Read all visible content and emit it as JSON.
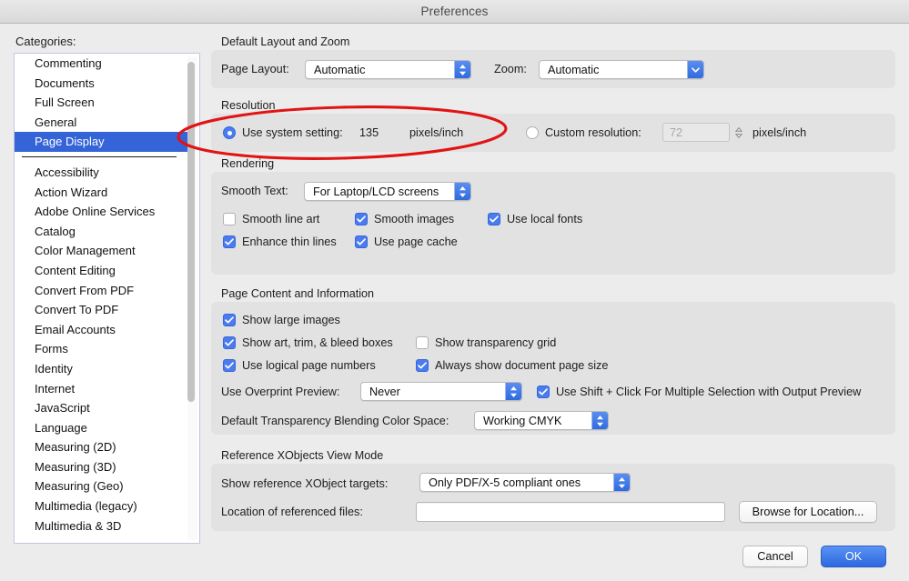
{
  "window": {
    "title": "Preferences"
  },
  "sidebar": {
    "label": "Categories:",
    "items": [
      {
        "label": "Commenting",
        "selected": false
      },
      {
        "label": "Documents",
        "selected": false
      },
      {
        "label": "Full Screen",
        "selected": false
      },
      {
        "label": "General",
        "selected": false
      },
      {
        "label": "Page Display",
        "selected": true
      },
      {
        "label": "Accessibility",
        "selected": false
      },
      {
        "label": "Action Wizard",
        "selected": false
      },
      {
        "label": "Adobe Online Services",
        "selected": false
      },
      {
        "label": "Catalog",
        "selected": false
      },
      {
        "label": "Color Management",
        "selected": false
      },
      {
        "label": "Content Editing",
        "selected": false
      },
      {
        "label": "Convert From PDF",
        "selected": false
      },
      {
        "label": "Convert To PDF",
        "selected": false
      },
      {
        "label": "Email Accounts",
        "selected": false
      },
      {
        "label": "Forms",
        "selected": false
      },
      {
        "label": "Identity",
        "selected": false
      },
      {
        "label": "Internet",
        "selected": false
      },
      {
        "label": "JavaScript",
        "selected": false
      },
      {
        "label": "Language",
        "selected": false
      },
      {
        "label": "Measuring (2D)",
        "selected": false
      },
      {
        "label": "Measuring (3D)",
        "selected": false
      },
      {
        "label": "Measuring (Geo)",
        "selected": false
      },
      {
        "label": "Multimedia (legacy)",
        "selected": false
      },
      {
        "label": "Multimedia & 3D",
        "selected": false
      }
    ]
  },
  "layout_zoom": {
    "group_title": "Default Layout and Zoom",
    "page_layout_label": "Page Layout:",
    "page_layout_value": "Automatic",
    "zoom_label": "Zoom:",
    "zoom_value": "Automatic"
  },
  "resolution": {
    "group_title": "Resolution",
    "system_label": "Use system setting:",
    "system_value": "135",
    "system_units": "pixels/inch",
    "system_selected": true,
    "custom_label": "Custom resolution:",
    "custom_placeholder": "72",
    "custom_units": "pixels/inch",
    "custom_selected": false
  },
  "rendering": {
    "group_title": "Rendering",
    "smooth_text_label": "Smooth Text:",
    "smooth_text_value": "For Laptop/LCD screens",
    "checkboxes": [
      {
        "label": "Smooth line art",
        "checked": false
      },
      {
        "label": "Smooth images",
        "checked": true
      },
      {
        "label": "Use local fonts",
        "checked": true
      },
      {
        "label": "Enhance thin lines",
        "checked": true
      },
      {
        "label": "Use page cache",
        "checked": true
      }
    ]
  },
  "page_content": {
    "group_title": "Page Content and Information",
    "checkboxes": [
      {
        "label": "Show large images",
        "checked": true
      },
      {
        "label": "Show art, trim, & bleed boxes",
        "checked": true
      },
      {
        "label": "Show transparency grid",
        "checked": false
      },
      {
        "label": "Use logical page numbers",
        "checked": true
      },
      {
        "label": "Always show document page size",
        "checked": true
      },
      {
        "label": "Use Shift + Click For Multiple Selection with Output Preview",
        "checked": true
      }
    ],
    "overprint_label": "Use Overprint Preview:",
    "overprint_value": "Never",
    "blend_label": "Default Transparency Blending Color Space:",
    "blend_value": "Working CMYK"
  },
  "reference_xobjects": {
    "group_title": "Reference XObjects View Mode",
    "targets_label": "Show reference XObject targets:",
    "targets_value": "Only PDF/X-5 compliant ones",
    "location_label": "Location of referenced files:",
    "location_value": "",
    "browse_label": "Browse for Location..."
  },
  "footer": {
    "cancel_label": "Cancel",
    "ok_label": "OK"
  },
  "annotation": {
    "shape": "ellipse",
    "color": "#e11414"
  },
  "colors": {
    "accent": "#3464d7",
    "checkbox_on": "#4a7cf0",
    "annotation_red": "#e11414",
    "panel_bg": "#e2e2e2",
    "window_bg": "#ececec"
  }
}
